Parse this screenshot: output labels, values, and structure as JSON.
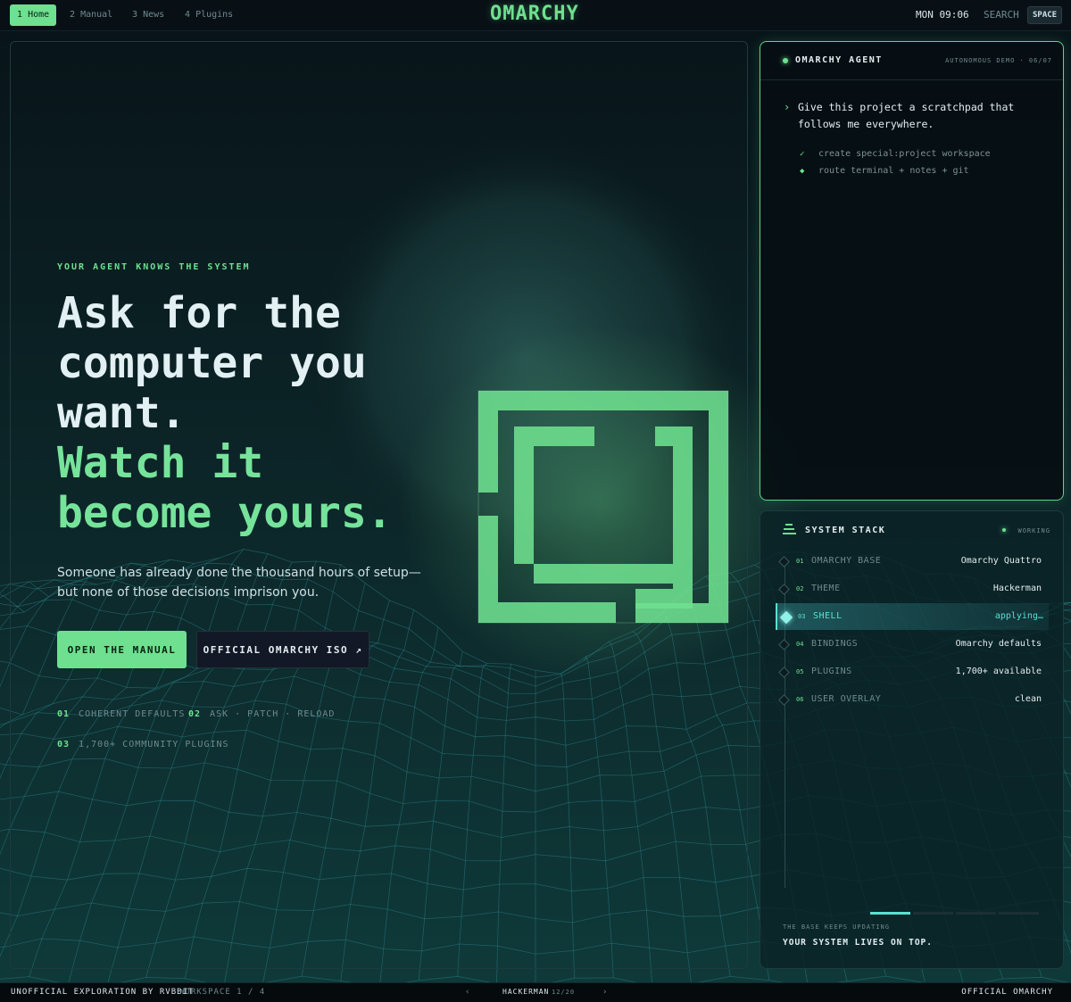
{
  "nav": {
    "workspaces": [
      {
        "num": "1",
        "label": "Home"
      },
      {
        "num": "2",
        "label": "Manual"
      },
      {
        "num": "3",
        "label": "News"
      },
      {
        "num": "4",
        "label": "Plugins"
      }
    ],
    "logo": "OMARCHY",
    "clock": "MON 09:06",
    "search_label": "SEARCH",
    "search_key": "SPACE"
  },
  "hero": {
    "eyebrow": "YOUR AGENT KNOWS THE SYSTEM",
    "headline_lines": [
      "Ask for the",
      "computer you",
      "want."
    ],
    "accent_lines": [
      "Watch it",
      "become yours."
    ],
    "subtitle_line1": "Someone has already done the thousand hours of setup—",
    "subtitle_line2": "but none of those decisions imprison you.",
    "primary_button": "OPEN THE MANUAL",
    "secondary_button": "OFFICIAL OMARCHY ISO ↗",
    "features": [
      {
        "num": "01",
        "label": "COHERENT DEFAULTS"
      },
      {
        "num": "02",
        "label": "ASK · PATCH · RELOAD"
      },
      {
        "num": "03",
        "label": "1,700+ COMMUNITY PLUGINS"
      }
    ]
  },
  "agent": {
    "title": "OMARCHY AGENT",
    "meta": "AUTONOMOUS DEMO · 06/07",
    "prompt": "Give this project a scratchpad that follows me everywhere.",
    "steps": [
      {
        "icon": "✓",
        "text": "create special:project workspace"
      },
      {
        "icon": "◆",
        "text": "route terminal + notes + git"
      }
    ]
  },
  "stack": {
    "title": "SYSTEM STACK",
    "status": "WORKING",
    "rows": [
      {
        "idx": "01",
        "name": "OMARCHY BASE",
        "value": "Omarchy Quattro"
      },
      {
        "idx": "02",
        "name": "THEME",
        "value": "Hackerman"
      },
      {
        "idx": "03",
        "name": "SHELL",
        "value": "applying…"
      },
      {
        "idx": "04",
        "name": "BINDINGS",
        "value": "Omarchy defaults"
      },
      {
        "idx": "05",
        "name": "PLUGINS",
        "value": "1,700+ available"
      },
      {
        "idx": "06",
        "name": "USER OVERLAY",
        "value": "clean"
      }
    ],
    "active_index": 2,
    "progress_segments": 4,
    "progress_active": 1,
    "footer_small": "THE BASE KEEPS UPDATING",
    "footer_big": "YOUR SYSTEM LIVES ON TOP."
  },
  "bottom": {
    "credit": "UNOFFICIAL EXPLORATION BY RVBBIT",
    "workspace": "WORKSPACE 1 / 4",
    "prev": "‹",
    "theme_name": "HACKERMAN",
    "theme_count": "12/20",
    "next": "›",
    "right": "OFFICIAL OMARCHY"
  },
  "colors": {
    "accent": "#6ee08f",
    "cyan": "#58e2d2",
    "background": "#071317"
  }
}
